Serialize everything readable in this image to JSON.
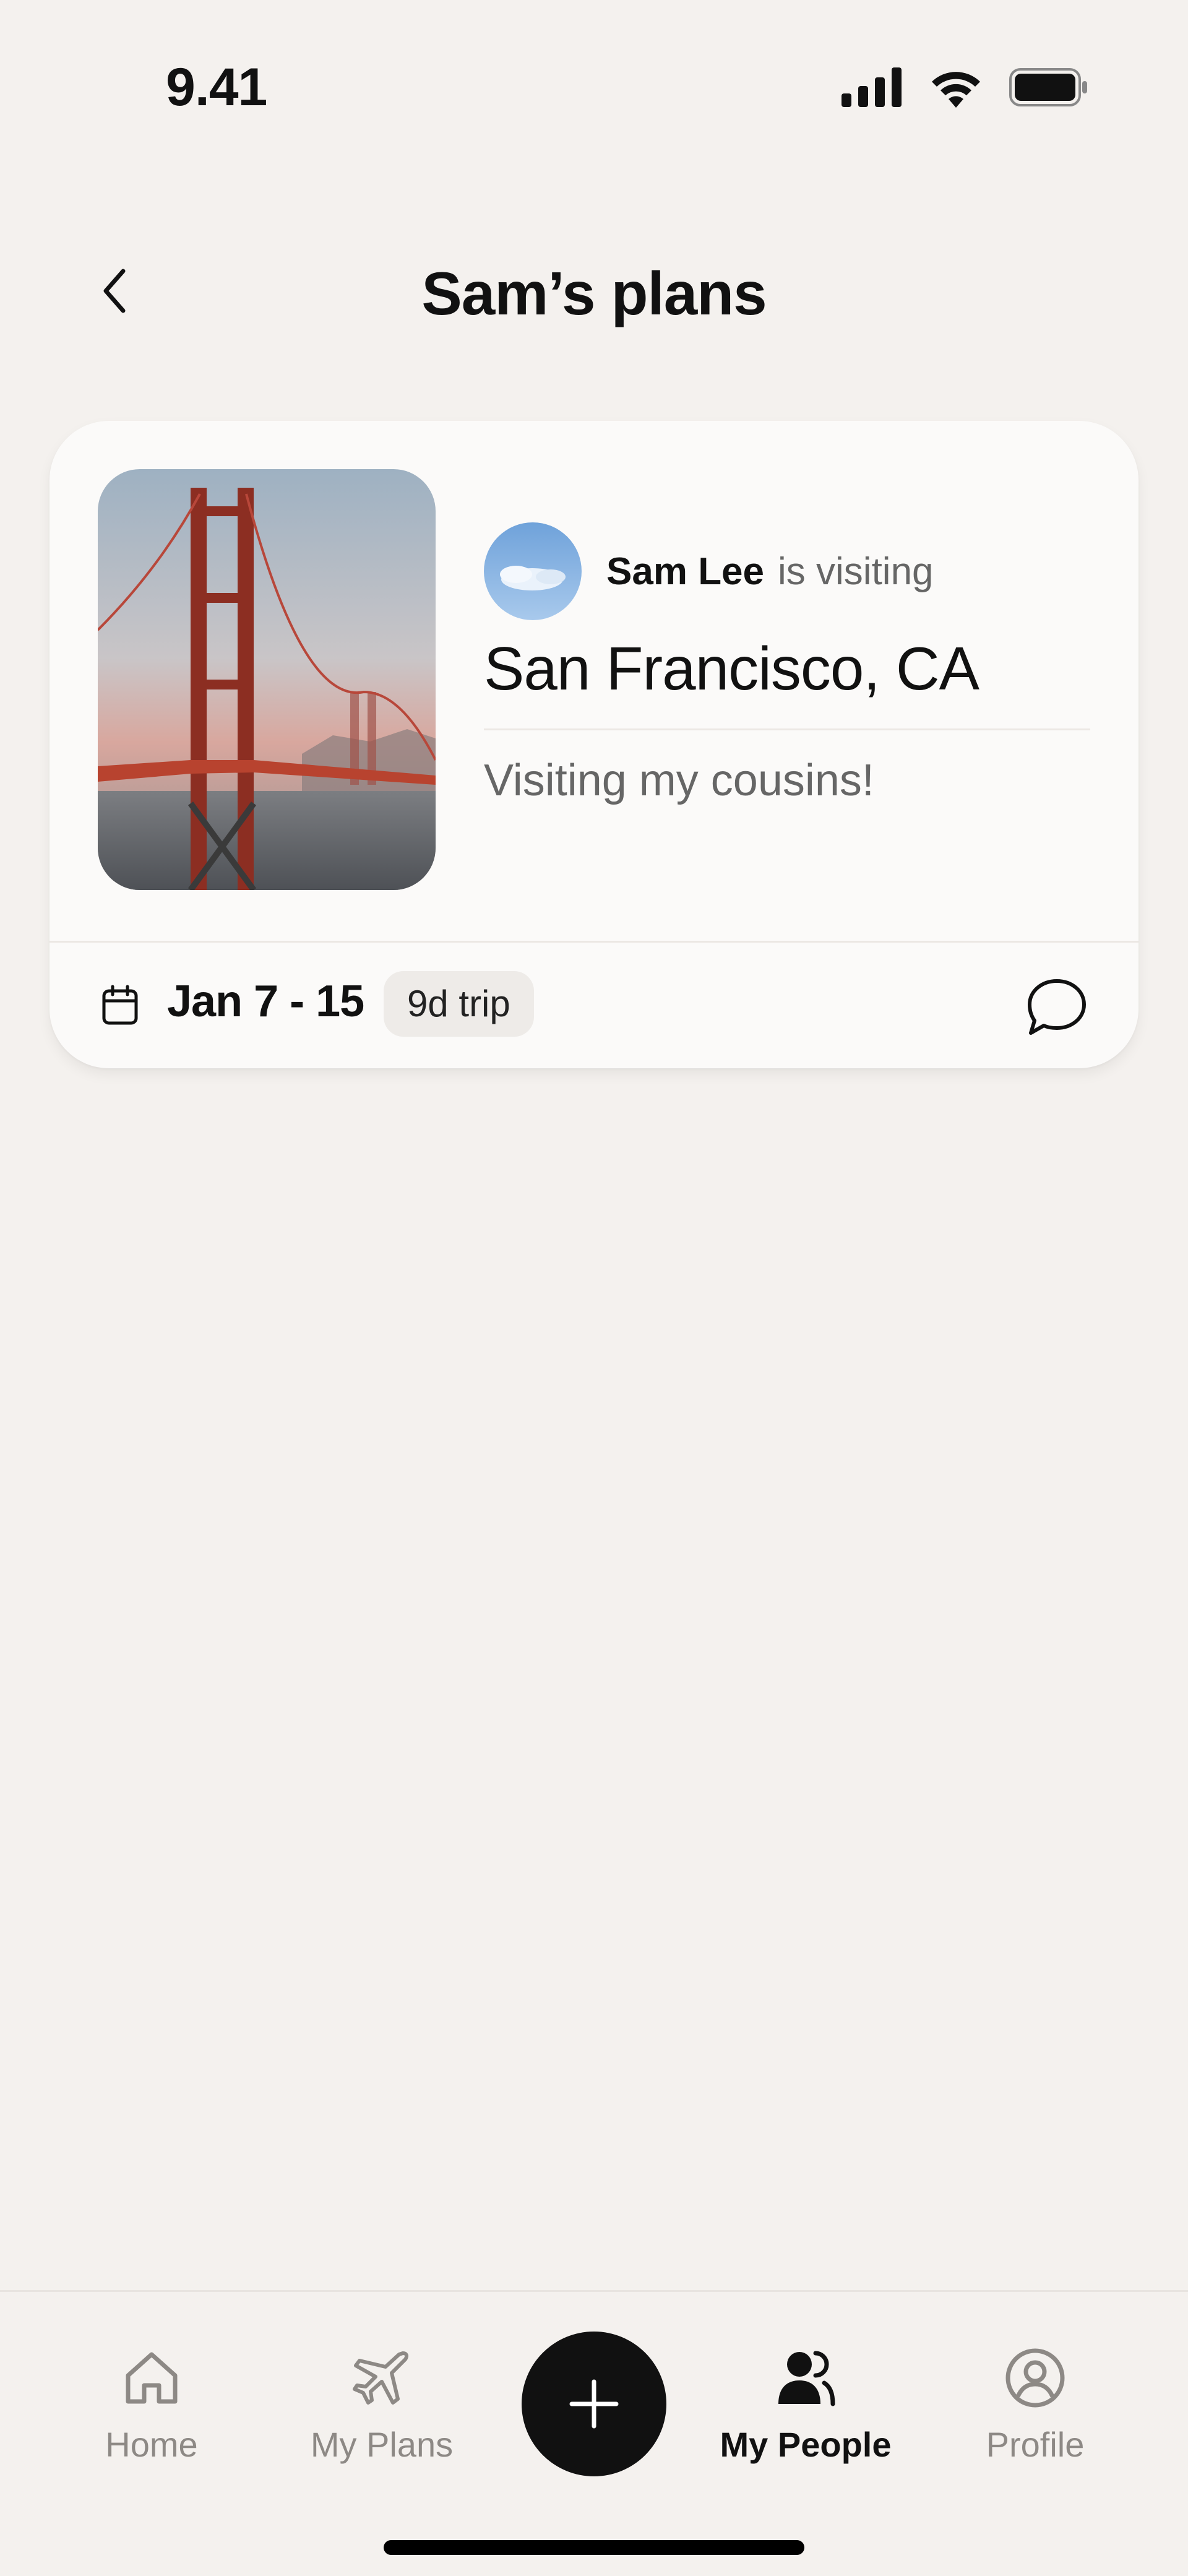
{
  "status_bar": {
    "time": "9.41",
    "icons": [
      "cellular-signal-icon",
      "wifi-icon",
      "battery-icon"
    ]
  },
  "header": {
    "title": "Sam’s plans",
    "back_icon": "chevron-left-icon"
  },
  "plan_card": {
    "photo": "golden-gate-bridge-photo",
    "avatar": "sky-avatar",
    "visitor_name": "Sam Lee",
    "visitor_verb": "is visiting",
    "destination": "San Francisco, CA",
    "note": "Visiting my cousins!",
    "dates": "Jan 7 - 15",
    "duration": "9d trip",
    "calendar_icon": "calendar-icon",
    "chat_icon": "chat-bubble-icon"
  },
  "tab_bar": {
    "tabs": [
      {
        "label": "Home",
        "icon": "home-icon",
        "active": false
      },
      {
        "label": "My Plans",
        "icon": "airplane-icon",
        "active": false
      },
      {
        "label": "My People",
        "icon": "people-icon",
        "active": true
      },
      {
        "label": "Profile",
        "icon": "profile-icon",
        "active": false
      }
    ],
    "fab_icon": "plus-icon"
  },
  "colors": {
    "background": "#F4F1EE",
    "card": "#FBFAF9",
    "text_primary": "#111111",
    "text_secondary": "#666666",
    "tab_inactive": "#8D8985",
    "fab": "#111111",
    "badge_bg": "#EEEBE8"
  }
}
